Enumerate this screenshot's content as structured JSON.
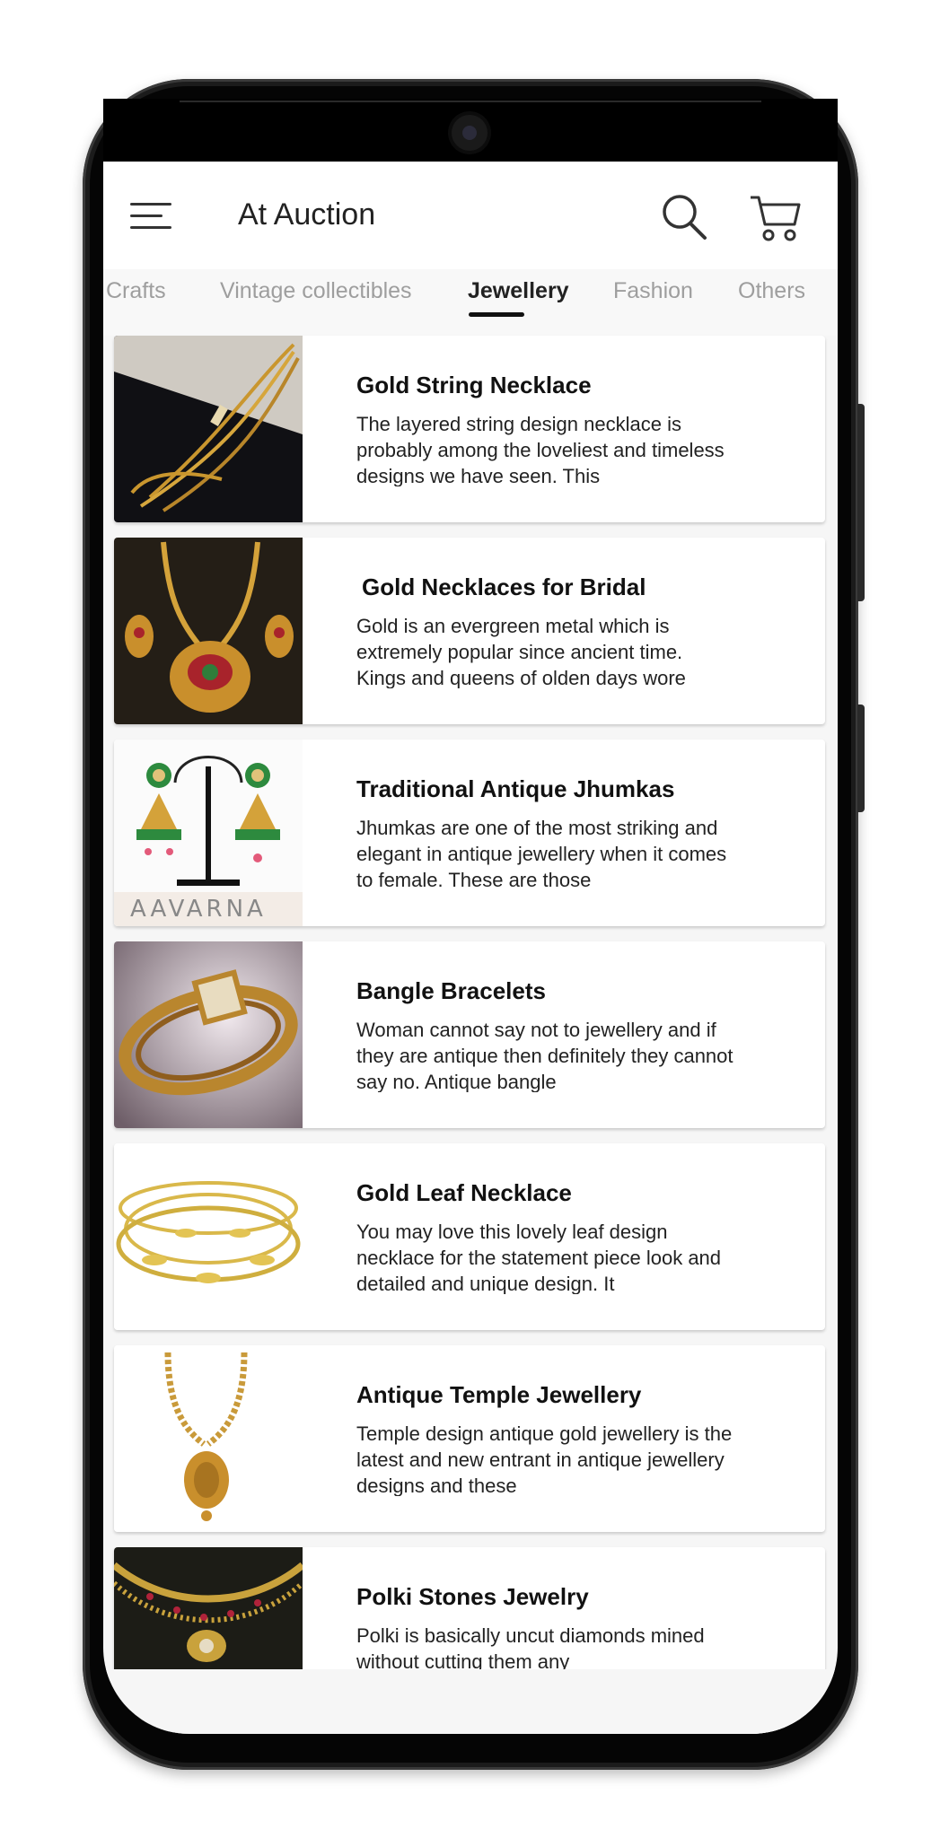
{
  "app": {
    "title": "At Auction"
  },
  "header": {
    "menu_icon": "hamburger-menu-icon",
    "search_icon": "search-icon",
    "cart_icon": "cart-icon"
  },
  "tabs": [
    {
      "label": "Crafts"
    },
    {
      "label": "Vintage collectibles"
    },
    {
      "label": "Jewellery",
      "active": true
    },
    {
      "label": "Fashion"
    },
    {
      "label": "Others"
    }
  ],
  "items": [
    {
      "title": "Gold String Necklace",
      "description": "The layered string design necklace is probably among the loveliest and timeless designs we have seen. This"
    },
    {
      "title": "Gold Necklaces for Bridal",
      "description": "Gold is an evergreen metal which is extremely popular since ancient time. Kings and queens of olden days wore"
    },
    {
      "title": "Traditional Antique Jhumkas",
      "description": "Jhumkas are one of the most striking and elegant in antique jewellery when it comes to female. These are those",
      "image_text": "AAVARNA"
    },
    {
      "title": "Bangle Bracelets",
      "description": "Woman cannot say not to jewellery and if they are antique then definitely they cannot say no. Antique bangle"
    },
    {
      "title": "Gold Leaf Necklace",
      "description": "You may love this lovely leaf design necklace for the statement piece look and detailed and unique design. It"
    },
    {
      "title": "Antique Temple Jewellery",
      "description": "Temple design antique gold jewellery is the latest and new entrant in antique jewellery designs and these"
    },
    {
      "title": "Polki Stones Jewelry",
      "description": "Polki is basically uncut diamonds mined without cutting them any"
    }
  ],
  "colors": {
    "accent": "#111111",
    "tab_inactive": "#9e9e9e",
    "gold": "#c9962e"
  }
}
